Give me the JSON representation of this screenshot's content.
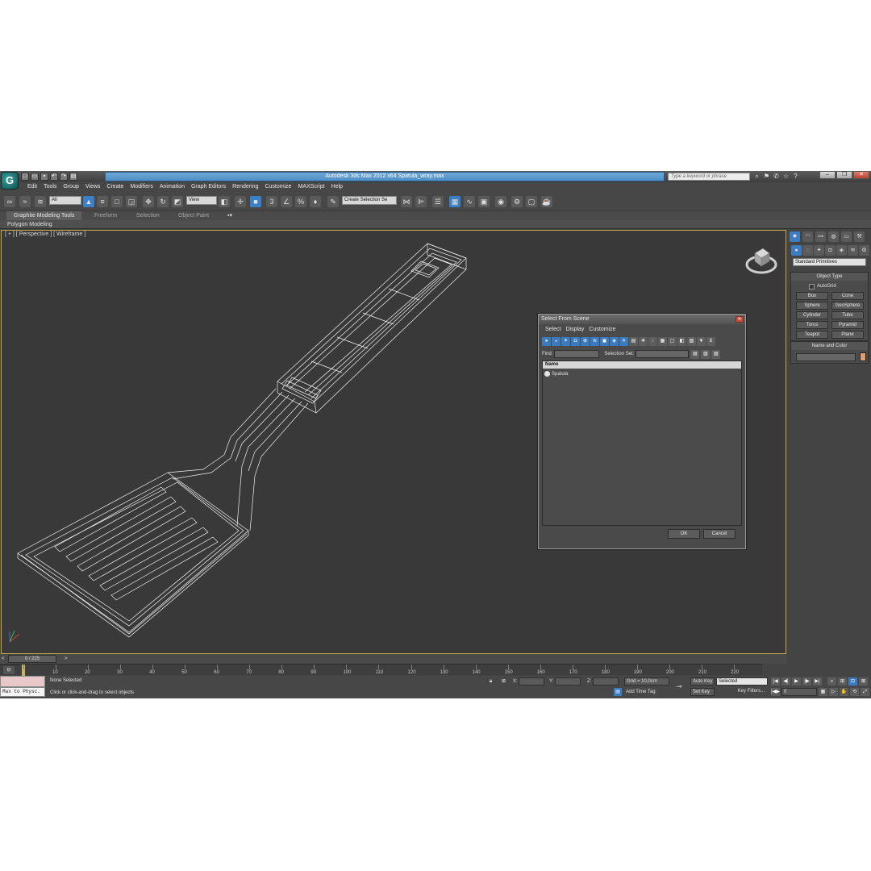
{
  "window": {
    "title": "Autodesk 3ds Max  2012 x64      Spatula_wray.max",
    "search_placeholder": "Type a keyword or phrase"
  },
  "menu": [
    "Edit",
    "Tools",
    "Group",
    "Views",
    "Create",
    "Modifiers",
    "Animation",
    "Graph Editors",
    "Rendering",
    "Customize",
    "MAXScript",
    "Help"
  ],
  "toolbar": {
    "selection_filter": "All",
    "reference_coord": "View",
    "named_selection": "Create Selection Se",
    "percent_snap": "%"
  },
  "ribbon": {
    "tabs": [
      "Graphite Modeling Tools",
      "Freeform",
      "Selection",
      "Object Paint"
    ],
    "panel": "Polygon Modeling"
  },
  "viewport": {
    "label": "[ + ] [ Perspective ] [ Wireframe ]"
  },
  "dialog": {
    "title": "Select From Scene",
    "menu": [
      "Select",
      "Display",
      "Customize"
    ],
    "find_label": "Find:",
    "selection_set_label": "Selection Set:",
    "column_name": "Name",
    "items": [
      "Spatula"
    ],
    "ok": "OK",
    "cancel": "Cancel"
  },
  "command_panel": {
    "category": "Standard Primitives",
    "object_type_title": "Object Type",
    "autogrid": "AutoGrid",
    "buttons": [
      "Box",
      "Cone",
      "Sphere",
      "GeoSphere",
      "Cylinder",
      "Tube",
      "Torus",
      "Pyramid",
      "Teapot",
      "Plane"
    ],
    "name_color_title": "Name and Color",
    "swatch_color": "#e0a070"
  },
  "timeline": {
    "frame_readout": "0 / 225",
    "ticks": [
      "0",
      "10",
      "20",
      "30",
      "40",
      "50",
      "60",
      "70",
      "80",
      "90",
      "100",
      "110",
      "120",
      "130",
      "140",
      "150",
      "160",
      "170",
      "180",
      "190",
      "200",
      "210",
      "220"
    ]
  },
  "status": {
    "max_to_phys": "Max to Physc.",
    "selection": "None Selected",
    "prompt": "Click or click-and-drag to select objects",
    "x_label": "X:",
    "y_label": "Y:",
    "z_label": "Z:",
    "grid": "Grid = 10,0cm",
    "add_time_tag": "Add Time Tag",
    "auto_key": "Auto Key",
    "set_key": "Set Key",
    "key_mode": "Selected",
    "key_filters": "Key Filters...",
    "frame": "0"
  },
  "colors": {
    "accent": "#3b7fc4",
    "viewport_border": "#c8a547",
    "viewport_bg": "#393939"
  }
}
